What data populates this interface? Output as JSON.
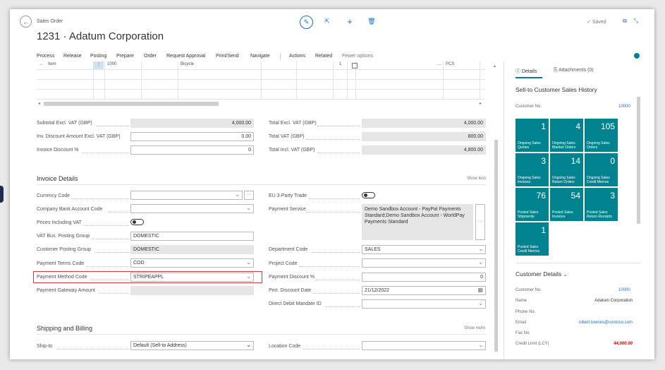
{
  "header": {
    "doc_type": "Sales Order",
    "title": "1231 · Adatum Corporation",
    "saved": "Saved"
  },
  "actions": [
    "Process",
    "Release",
    "Posting",
    "Prepare",
    "Order",
    "Request Approval",
    "Print/Send",
    "Navigate",
    "Actions",
    "Related",
    "Fewer options"
  ],
  "lines": {
    "type": "Item",
    "no": "1000",
    "description": "Bicycle",
    "quantity": "1",
    "unit": "PCS"
  },
  "totals": {
    "subtotal_label": "Subtotal Excl. VAT (GBP)",
    "subtotal_value": "4,000.00",
    "inv_disc_label": "Inv. Discount Amount Excl. VAT (GBP)",
    "inv_disc_value": "0.00",
    "inv_disc_pct_label": "Invoice Discount %",
    "inv_disc_pct_value": "0",
    "total_excl_label": "Total Excl. VAT (GBP)",
    "total_excl_value": "4,000.00",
    "total_vat_label": "Total VAT (GBP)",
    "total_vat_value": "800.00",
    "total_incl_label": "Total Incl. VAT (GBP)",
    "total_incl_value": "4,800.00"
  },
  "invoice": {
    "title": "Invoice Details",
    "show_less": "Show less",
    "currency_code": "Currency Code",
    "company_bank": "Company Bank Account Code",
    "prices_incl_vat": "Prices Including VAT",
    "vat_bus_label": "VAT Bus. Posting Group",
    "vat_bus_value": "DOMESTIC",
    "cust_post_label": "Customer Posting Group",
    "cust_post_value": "DOMESTIC",
    "pay_terms_label": "Payment Terms Code",
    "pay_terms_value": "COD",
    "pay_method_label": "Payment Method Code",
    "pay_method_value": "STRIPEAPPL",
    "gateway_label": "Payment Gateway Amount",
    "eu_label": "EU 3-Party Trade",
    "pay_service_label": "Payment Service",
    "pay_service_value": "Demo Sandbox Account - PayPal Payments Standard;Demo Sandbox Account - WorldPay Payments Standard",
    "dept_label": "Department Code",
    "dept_value": "SALES",
    "project_label": "Project Code",
    "pay_disc_label": "Payment Discount %",
    "pay_disc_value": "0",
    "pmt_date_label": "Pmt. Discount Date",
    "pmt_date_value": "21/12/2022",
    "direct_debit_label": "Direct Debit Mandate ID"
  },
  "shipping": {
    "title": "Shipping and Billing",
    "show_more": "Show more",
    "ship_to_label": "Ship-to",
    "ship_to_value": "Default (Sell-to Address)",
    "location_label": "Location Code"
  },
  "factbox": {
    "tab_details": "Details",
    "tab_attachments": "Attachments (0)",
    "history_title": "Sell-to Customer Sales History",
    "customer_no_label": "Customer No.",
    "customer_no_value": "10000",
    "tiles": [
      {
        "num": "1",
        "cap": "Ongoing Sales Quotes"
      },
      {
        "num": "4",
        "cap": "Ongoing Sales Blanket Orders"
      },
      {
        "num": "105",
        "cap": "Ongoing Sales Orders"
      },
      {
        "num": "3",
        "cap": "Ongoing Sales Invoices"
      },
      {
        "num": "14",
        "cap": "Ongoing Sales Return Orders"
      },
      {
        "num": "0",
        "cap": "Ongoing Sales Credit Memos"
      },
      {
        "num": "76",
        "cap": "Posted Sales Shipments"
      },
      {
        "num": "54",
        "cap": "Posted Sales Invoices"
      },
      {
        "num": "3",
        "cap": "Posted Sales Return Receipts"
      },
      {
        "num": "1",
        "cap": "Posted Sales Credit Memos"
      }
    ],
    "cust_details_title": "Customer Details",
    "cd_no_label": "Customer No.",
    "cd_no_value": "10000",
    "name_label": "Name",
    "name_value": "Adatum Corporation",
    "phone_label": "Phone No.",
    "email_label": "Email",
    "email_value": "robert.townes@contoso.com",
    "fax_label": "Fax No.",
    "credit_label": "Credit Limit (LCY)",
    "credit_value": "44,000.00"
  },
  "colors": {
    "accent": "#00838f",
    "link": "#1b6fbf",
    "highlight": "#d9363e",
    "credit": "#d40000"
  }
}
